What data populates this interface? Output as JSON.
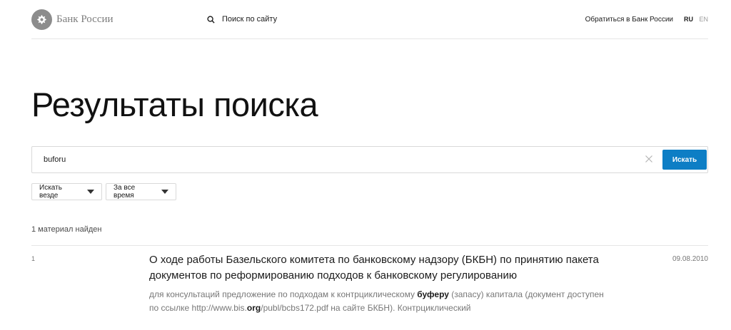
{
  "header": {
    "logo_text": "Банк России",
    "site_search_label": "Поиск по сайту",
    "contact_link": "Обратиться в Банк России",
    "lang_ru": "RU",
    "lang_en": "EN"
  },
  "page": {
    "title": "Результаты поиска"
  },
  "search": {
    "query": "buforu",
    "button_label": "Искать"
  },
  "filters": {
    "where": "Искать везде",
    "time": "За все время"
  },
  "results": {
    "count_text": "1 материал найден",
    "items": [
      {
        "index": "1",
        "title": "О ходе работы Базельского комитета по банковскому надзору (БКБН) по принятию пакета документов по реформированию подходов к банковскому регулированию",
        "date": "09.08.2010",
        "snippet_1": "для консультаций предложение по подходам к контрциклическому ",
        "snippet_hl_1": "буферу",
        "snippet_2": " (запасу) капитала (документ доступен по ссылке http://www.bis.",
        "snippet_hl_2": "org",
        "snippet_3": "/publ/bcbs172.pdf на сайте БКБН). Контрциклический"
      }
    ]
  },
  "colors": {
    "accent": "#0d7ec5",
    "logo_gray": "#8c8c8c"
  },
  "icons": {
    "logo": "bank-emblem-icon",
    "search": "search-icon",
    "clear": "close-icon",
    "dropdown": "caret-down-icon"
  }
}
